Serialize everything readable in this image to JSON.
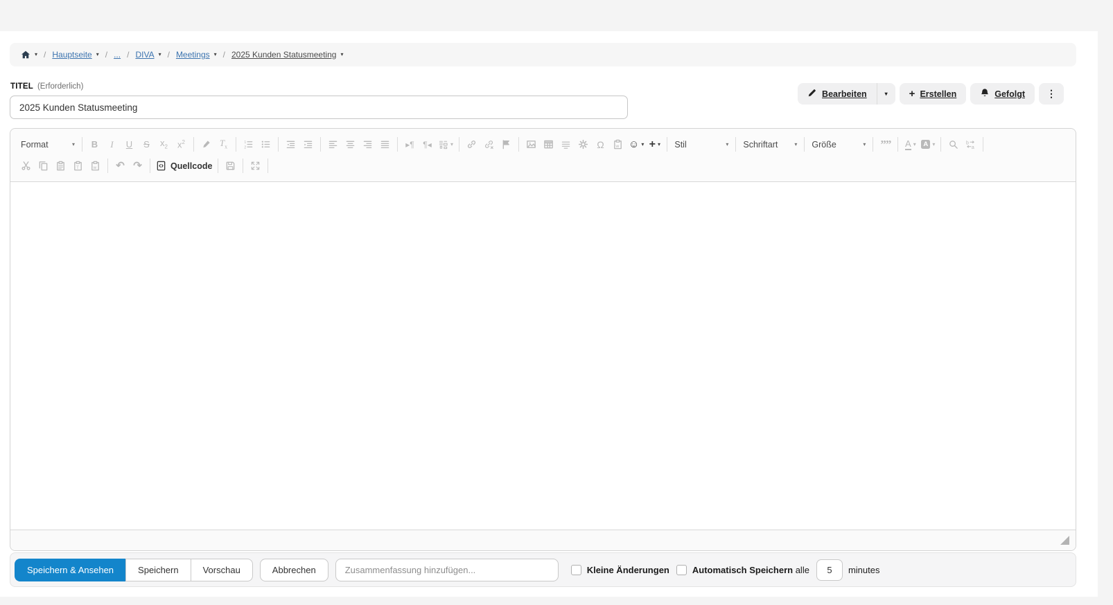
{
  "breadcrumb": {
    "items": [
      {
        "label": "Hauptseite",
        "caret": true,
        "current": false
      },
      {
        "label": "...",
        "caret": false,
        "current": false
      },
      {
        "label": "DIVA",
        "caret": true,
        "current": false
      },
      {
        "label": "Meetings",
        "caret": true,
        "current": false
      },
      {
        "label": "2025 Kunden Statusmeeting",
        "caret": true,
        "current": true
      }
    ]
  },
  "title_field": {
    "label": "TITEL",
    "hint": "(Erforderlich)",
    "value": "2025 Kunden Statusmeeting"
  },
  "page_actions": {
    "edit": "Bearbeiten",
    "create": "Erstellen",
    "follow": "Gefolgt"
  },
  "editor": {
    "toolbar_row1": [
      {
        "type": "combo",
        "name": "format",
        "label": "Format"
      },
      {
        "type": "sep"
      },
      {
        "type": "btn",
        "name": "bold",
        "icon": "bold"
      },
      {
        "type": "btn",
        "name": "italic",
        "icon": "italic"
      },
      {
        "type": "btn",
        "name": "underline",
        "icon": "underline"
      },
      {
        "type": "btn",
        "name": "strikethrough",
        "icon": "strike"
      },
      {
        "type": "btn",
        "name": "subscript",
        "icon": "subscript"
      },
      {
        "type": "btn",
        "name": "superscript",
        "icon": "superscript"
      },
      {
        "type": "sep"
      },
      {
        "type": "btn",
        "name": "copy-formatting",
        "icon": "copyformat"
      },
      {
        "type": "btn",
        "name": "remove-format",
        "icon": "removeformat"
      },
      {
        "type": "sep"
      },
      {
        "type": "btn",
        "name": "numbered-list",
        "icon": "numberedlist"
      },
      {
        "type": "btn",
        "name": "bulleted-list",
        "icon": "bulletlist"
      },
      {
        "type": "sep"
      },
      {
        "type": "btn",
        "name": "decrease-indent",
        "icon": "outdent"
      },
      {
        "type": "btn",
        "name": "increase-indent",
        "icon": "indent"
      },
      {
        "type": "sep"
      },
      {
        "type": "btn",
        "name": "align-left",
        "icon": "alignleft"
      },
      {
        "type": "btn",
        "name": "align-center",
        "icon": "aligncenter"
      },
      {
        "type": "btn",
        "name": "align-right",
        "icon": "alignright"
      },
      {
        "type": "btn",
        "name": "justify",
        "icon": "justify"
      },
      {
        "type": "sep"
      },
      {
        "type": "btn",
        "name": "text-direction-ltr",
        "icon": "bidiltr"
      },
      {
        "type": "btn",
        "name": "text-direction-rtl",
        "icon": "bidirtl"
      },
      {
        "type": "btn",
        "name": "language",
        "icon": "language",
        "caret": true
      },
      {
        "type": "sep"
      },
      {
        "type": "btn",
        "name": "insert-link",
        "icon": "link"
      },
      {
        "type": "btn",
        "name": "remove-link",
        "icon": "unlink"
      },
      {
        "type": "btn",
        "name": "bookmark",
        "icon": "bookmark"
      },
      {
        "type": "sep"
      },
      {
        "type": "btn",
        "name": "insert-image",
        "icon": "image"
      },
      {
        "type": "btn",
        "name": "insert-table",
        "icon": "table"
      },
      {
        "type": "btn",
        "name": "horizontal-line",
        "icon": "horizontalline"
      },
      {
        "type": "btn",
        "name": "insert-macro",
        "icon": "macro"
      },
      {
        "type": "btn",
        "name": "special-character",
        "icon": "specialchar"
      },
      {
        "type": "btn",
        "name": "paste-from-office",
        "icon": "pasteword"
      },
      {
        "type": "btn",
        "name": "emoji",
        "icon": "emoji",
        "caret": true,
        "enabled": true
      },
      {
        "type": "btn",
        "name": "quick-insert",
        "icon": "plus",
        "caret": true,
        "enabled": true
      },
      {
        "type": "sep"
      },
      {
        "type": "combo",
        "name": "style",
        "label": "Stil"
      },
      {
        "type": "sep"
      },
      {
        "type": "combo",
        "name": "font",
        "label": "Schriftart"
      },
      {
        "type": "sep"
      },
      {
        "type": "combo",
        "name": "size",
        "label": "Größe"
      },
      {
        "type": "sep"
      },
      {
        "type": "btn",
        "name": "blockquote",
        "icon": "blockquote"
      },
      {
        "type": "sep"
      },
      {
        "type": "btn",
        "name": "text-color",
        "icon": "textcolor",
        "caret": true
      },
      {
        "type": "btn",
        "name": "background-color",
        "icon": "bgcolor",
        "caret": true
      },
      {
        "type": "sep"
      },
      {
        "type": "btn",
        "name": "find",
        "icon": "find"
      },
      {
        "type": "btn",
        "name": "replace",
        "icon": "replace"
      },
      {
        "type": "sep"
      }
    ],
    "toolbar_row2": [
      {
        "type": "btn",
        "name": "cut",
        "icon": "cut"
      },
      {
        "type": "btn",
        "name": "copy",
        "icon": "copy"
      },
      {
        "type": "btn",
        "name": "paste",
        "icon": "paste"
      },
      {
        "type": "btn",
        "name": "paste-as-text",
        "icon": "pastetext"
      },
      {
        "type": "btn",
        "name": "paste-from-word",
        "icon": "pasteword"
      },
      {
        "type": "sep"
      },
      {
        "type": "btn",
        "name": "undo",
        "icon": "undo"
      },
      {
        "type": "btn",
        "name": "redo",
        "icon": "redo"
      },
      {
        "type": "sep"
      },
      {
        "type": "btn",
        "name": "source",
        "icon": "source",
        "label": "Quellcode",
        "enabled": true
      },
      {
        "type": "sep"
      },
      {
        "type": "btn",
        "name": "save",
        "icon": "save"
      },
      {
        "type": "sep"
      },
      {
        "type": "btn",
        "name": "maximize",
        "icon": "maximize"
      },
      {
        "type": "sep"
      }
    ]
  },
  "footer": {
    "save_and_view": "Speichern & Ansehen",
    "save": "Speichern",
    "preview": "Vorschau",
    "cancel": "Abbrechen",
    "summary_placeholder": "Zusammenfassung hinzufügen...",
    "minor_edit": "Kleine Änderungen",
    "autosave": "Automatisch Speichern",
    "autosave_every": "alle",
    "autosave_value": "5",
    "autosave_unit": "minutes"
  },
  "colors": {
    "primary": "#1385cb",
    "link": "#3b73af",
    "disabled_icon": "#b9b9b9",
    "enabled_icon": "#3c3c3c"
  }
}
